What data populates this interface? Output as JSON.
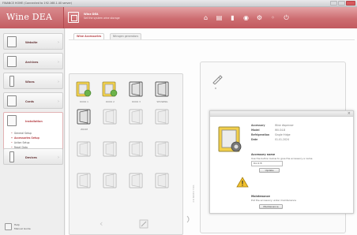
{
  "window": {
    "title": "FINANCE HOME (Connected to 192.168.1.40 server)"
  },
  "brand": {
    "name": "Wine DEA",
    "accent": "#c8656a"
  },
  "header": {
    "title": "Wine DEA",
    "subtitle": "Set the system wine storage",
    "tool_icons": [
      "home-icon",
      "cabinet-icon",
      "bottle-icon",
      "bell-icon",
      "gear-icon",
      "help-icon",
      "power-icon"
    ]
  },
  "sidebar": {
    "items": [
      {
        "label": "Website",
        "icon": "website-icon"
      },
      {
        "label": "Archives",
        "icon": "archives-icon"
      },
      {
        "label": "Wines",
        "icon": "wines-icon"
      },
      {
        "label": "Cards",
        "icon": "cards-icon"
      },
      {
        "label": "Installation",
        "icon": "installation-icon"
      },
      {
        "label": "Devices",
        "icon": "devices-icon"
      }
    ],
    "subitems": [
      "General Setup",
      "Accessories Setup",
      "Action Setup",
      "Reset Data"
    ],
    "footer": {
      "line1": "Help",
      "line2": "Manual Guide"
    }
  },
  "main": {
    "tabs": [
      "Wine Accessories",
      "Nitrogen generators"
    ],
    "tiles": [
      {
        "label": "DOCK 1",
        "state": "active"
      },
      {
        "label": "DOCK 2",
        "state": "active"
      },
      {
        "label": "DOCK 3",
        "state": "normal"
      },
      {
        "label": "SHOWING",
        "state": "normal"
      },
      {
        "label": "ZOOM",
        "state": "normal"
      }
    ],
    "right_panel_label": "B",
    "connector_text": "CONNECTOR"
  },
  "popup": {
    "details": [
      {
        "label": "Accessory",
        "value": "Wine dispenser"
      },
      {
        "label": "Model",
        "value": "WV-S4-B"
      },
      {
        "label": "Refrigeration",
        "value": "Single fridge"
      },
      {
        "label": "Date",
        "value": "01-01-2024"
      }
    ],
    "accessory_name": {
      "title": "Accessory name",
      "desc": "Use the button below to give the accessory a name",
      "value": "Dock B",
      "button": "Update"
    },
    "maintenance": {
      "title": "Maintenance",
      "desc": "Put the accessory under maintenance",
      "button": "Maintenance"
    }
  }
}
